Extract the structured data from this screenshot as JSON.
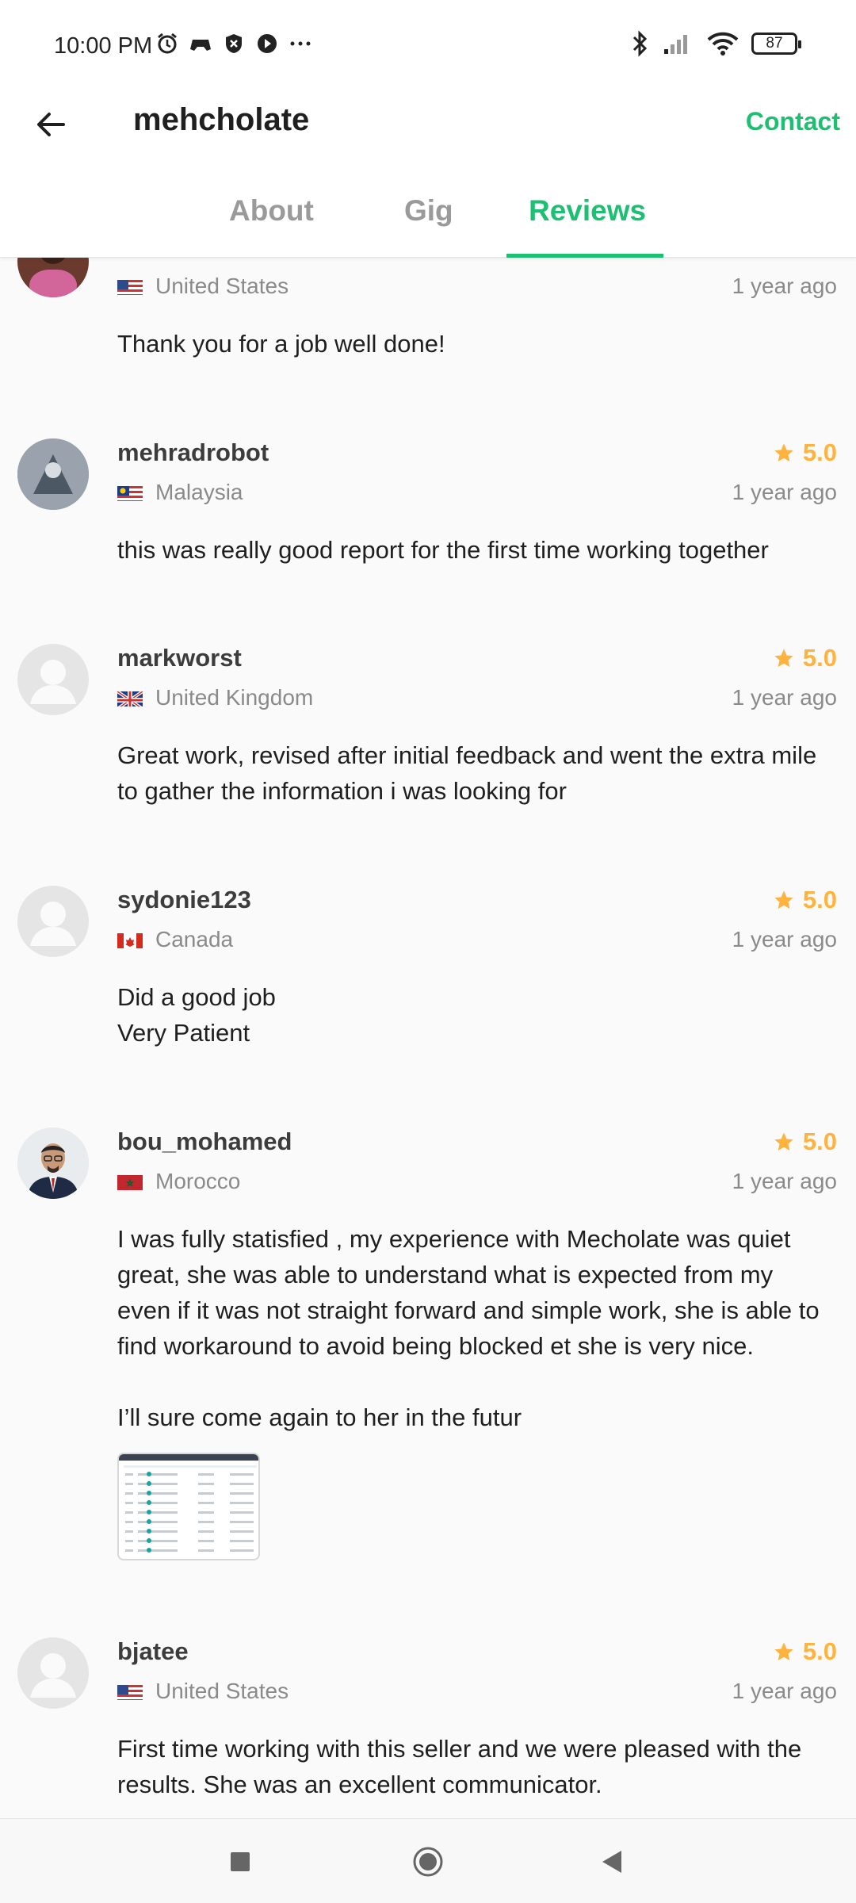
{
  "status_bar": {
    "time": "10:00 PM",
    "battery": "87",
    "left_icons": [
      "alarm-icon",
      "game-icon",
      "shield-icon",
      "play-icon",
      "more-dots-icon"
    ],
    "right_icons": [
      "bluetooth-icon",
      "signal-icon",
      "wifi-icon",
      "battery-icon"
    ]
  },
  "header": {
    "title": "mehcholate",
    "contact_label": "Contact",
    "back_icon": "arrow-left-icon"
  },
  "tabs": {
    "items": [
      {
        "label": "About"
      },
      {
        "label": "Gig"
      },
      {
        "label": "Reviews"
      }
    ],
    "active": "Reviews"
  },
  "colors": {
    "accent": "#1dbf73",
    "rating": "#ffb33e"
  },
  "reviews": [
    {
      "country": "United States",
      "time": "1 year ago",
      "text": "Thank you for a job well done!"
    },
    {
      "username": "mehradrobot",
      "rating": "5.0",
      "country": "Malaysia",
      "time": "1 year ago",
      "text": "this was really good report for the first time working together"
    },
    {
      "username": "markworst",
      "rating": "5.0",
      "country": "United Kingdom",
      "time": "1 year ago",
      "text": "Great work, revised after initial feedback and went the extra mile to gather the information i was looking for"
    },
    {
      "username": "sydonie123",
      "rating": "5.0",
      "country": "Canada",
      "time": "1 year ago",
      "text": "Did a good job\nVery Patient"
    },
    {
      "username": "bou_mohamed",
      "rating": "5.0",
      "country": "Morocco",
      "time": "1 year ago",
      "text": "I was fully statisfied , my experience with Mecholate was quiet great, she was able to understand what is expected from my even if it was not straight forward and simple work, she is able to find workaround to avoid being blocked et she is very nice.\n\nI’ll sure come again to her in the futur"
    },
    {
      "username": "bjatee",
      "rating": "5.0",
      "country": "United States",
      "time": "1 year ago",
      "text": "First time working with this seller and we were pleased with the results.  She was an excellent communicator."
    }
  ],
  "navbar": {
    "icons": [
      "recents-square-icon",
      "home-circle-icon",
      "back-triangle-icon"
    ]
  }
}
